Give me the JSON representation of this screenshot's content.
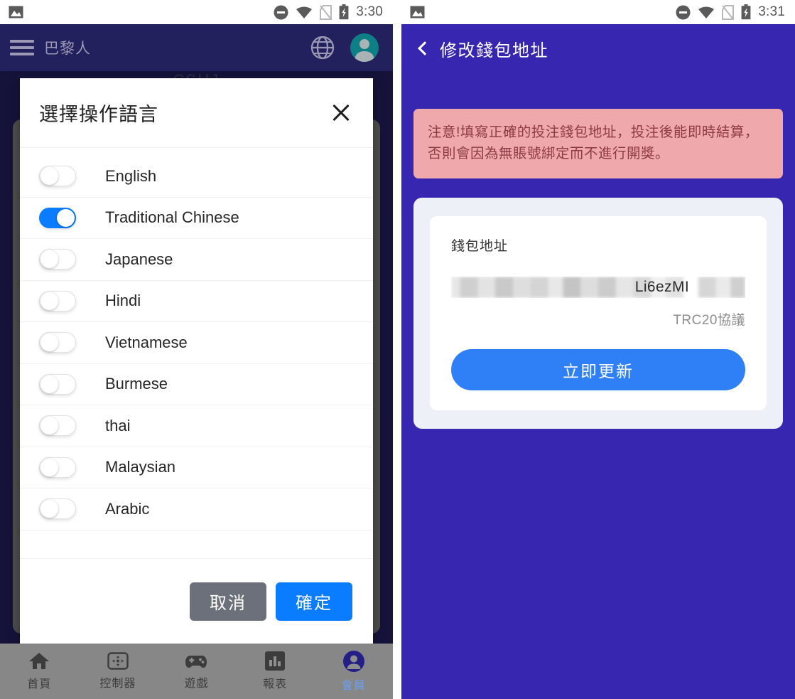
{
  "left_phone": {
    "status_bar": {
      "time": "3:30",
      "icons": [
        "image-icon",
        "do-not-disturb-icon",
        "wifi-icon",
        "no-sim-icon",
        "battery-charging-icon"
      ]
    },
    "app_bar": {
      "menu_icon": "hamburger-icon",
      "title": "巴黎人",
      "globe_icon": "globe-icon",
      "avatar_icon": "avatar-icon"
    },
    "background": {
      "faint_text": "CSHJ"
    },
    "dialog": {
      "title": "選擇操作語言",
      "close_icon": "close-icon",
      "languages": [
        {
          "label": "English",
          "on": false
        },
        {
          "label": "Traditional Chinese",
          "on": true
        },
        {
          "label": "Japanese",
          "on": false
        },
        {
          "label": "Hindi",
          "on": false
        },
        {
          "label": "Vietnamese",
          "on": false
        },
        {
          "label": "Burmese",
          "on": false
        },
        {
          "label": "thai",
          "on": false
        },
        {
          "label": "Malaysian",
          "on": false
        },
        {
          "label": "Arabic",
          "on": false
        }
      ],
      "cancel_label": "取消",
      "confirm_label": "確定"
    },
    "bottom_nav": [
      {
        "label": "首頁",
        "icon": "home-icon",
        "active": false
      },
      {
        "label": "控制器",
        "icon": "controller-icon",
        "active": false
      },
      {
        "label": "遊戲",
        "icon": "gamepad-icon",
        "active": false
      },
      {
        "label": "報表",
        "icon": "chart-icon",
        "active": false
      },
      {
        "label": "會員",
        "icon": "member-icon",
        "active": true
      }
    ]
  },
  "right_phone": {
    "status_bar": {
      "time": "3:31",
      "icons": [
        "image-icon",
        "do-not-disturb-icon",
        "wifi-icon",
        "no-sim-icon",
        "battery-charging-icon"
      ]
    },
    "app_bar": {
      "back_icon": "chevron-left-icon",
      "title": "修改錢包地址"
    },
    "notice": {
      "text": "注意!填寫正確的投注錢包地址，投注後能即時結算，否則會因為無賬號綁定而不進行開獎。"
    },
    "wallet_card": {
      "field_label": "錢包地址",
      "address_visible_fragment": "Li6ezMI",
      "protocol_label": "TRC20協議",
      "update_button_label": "立即更新"
    }
  },
  "colors": {
    "left_app_bar": "#23205e",
    "right_app_bar": "#3626b0",
    "accent_blue": "#0a7cff",
    "update_blue": "#2f80f7",
    "cancel_gray": "#6c707a",
    "notice_bg": "#efa8ac",
    "notice_text": "#8d3a45",
    "card_outer": "#eef0f7",
    "nav_bar": "#878787",
    "nav_active_text": "#6f9ee8"
  }
}
